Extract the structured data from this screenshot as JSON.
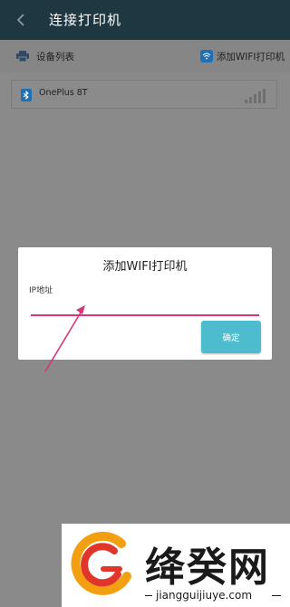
{
  "header": {
    "title": "连接打印机",
    "back_icon": "chevron-left-icon"
  },
  "toolbar": {
    "device_list_label": "设备列表",
    "device_list_icon": "printer-icon",
    "add_wifi_label": "添加WIFI打印机",
    "add_wifi_icon": "wifi-icon"
  },
  "devices": [
    {
      "name": "OnePlus 8T",
      "icon": "bluetooth-icon",
      "signal_bars": 4
    }
  ],
  "dialog": {
    "title": "添加WIFI打印机",
    "ip_label": "IP地址",
    "ip_value": "",
    "confirm_label": "确定"
  },
  "colors": {
    "header_bg": "#1f3740",
    "input_underline": "#d6357a",
    "confirm_bg": "#4dbccf",
    "arrow": "#d6357a"
  },
  "watermark": {
    "brand": "绛癸网",
    "url": "jiangguijiuye.com"
  }
}
